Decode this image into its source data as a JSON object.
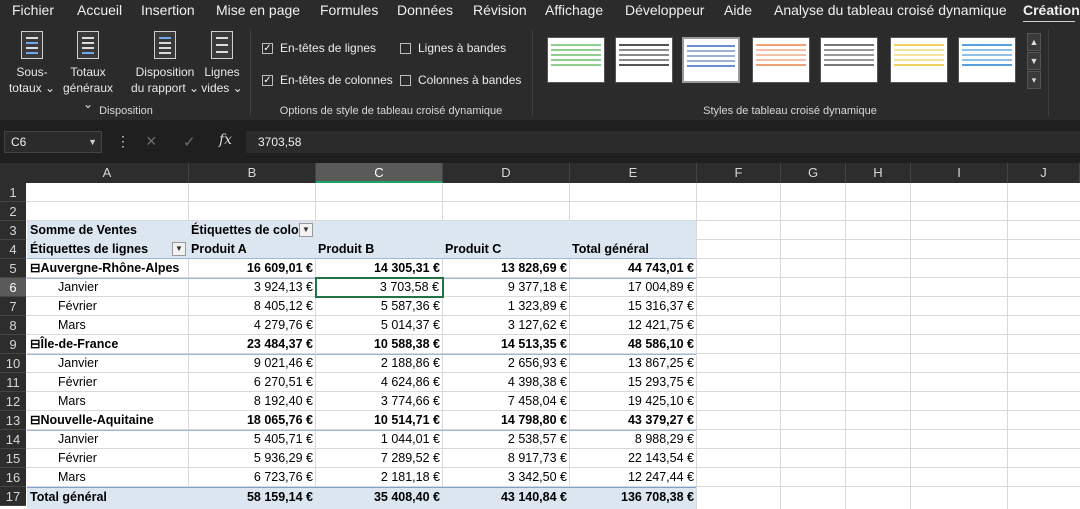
{
  "menu": {
    "tabs": [
      "Fichier",
      "Accueil",
      "Insertion",
      "Mise en page",
      "Formules",
      "Données",
      "Révision",
      "Affichage",
      "Développeur",
      "Aide",
      "Analyse du tableau croisé dynamique",
      "Création"
    ],
    "active": "Création"
  },
  "ribbon": {
    "disposition": {
      "buttons": [
        {
          "line1": "Sous-",
          "line2": "totaux ⌄"
        },
        {
          "line1": "Totaux",
          "line2": "généraux ⌄"
        },
        {
          "line1": "Disposition",
          "line2": "du rapport ⌄"
        },
        {
          "line1": "Lignes",
          "line2": "vides ⌄"
        }
      ],
      "label": "Disposition"
    },
    "options": {
      "checks": [
        {
          "label": "En-têtes de lignes",
          "checked": true
        },
        {
          "label": "Lignes à bandes",
          "checked": false
        },
        {
          "label": "En-têtes de colonnes",
          "checked": true
        },
        {
          "label": "Colonnes à bandes",
          "checked": false
        }
      ],
      "label": "Options de style de tableau croisé dynamique"
    },
    "styles": {
      "label": "Styles de tableau croisé dynamique",
      "swatches": [
        "#8fce8f",
        "#8a8a8a",
        "#6b8fd6",
        "#f0a078",
        "#9a9a9a",
        "#f2d060",
        "#5aa0e0"
      ],
      "selected_index": 2
    }
  },
  "formula_bar": {
    "name_box": "C6",
    "cancel_icon": "×",
    "enter_icon": "✓",
    "fx": "fx",
    "value": "3703,58"
  },
  "grid": {
    "columns": [
      "A",
      "B",
      "C",
      "D",
      "E",
      "F",
      "G",
      "H",
      "I",
      "J"
    ],
    "selected_column": "C",
    "rows": [
      "1",
      "2",
      "3",
      "4",
      "5",
      "6",
      "7",
      "8",
      "9",
      "10",
      "11",
      "12",
      "13",
      "14",
      "15",
      "16",
      "17"
    ],
    "selected_row": "6"
  },
  "pivot": {
    "values_label": "Somme de Ventes",
    "col_labels_label": "Étiquettes de colo",
    "row_labels_label": "Étiquettes de lignes",
    "headers": [
      "Produit A",
      "Produit B",
      "Produit C",
      "Total général"
    ],
    "rows": [
      {
        "label": "⊟Auvergne-Rhône-Alpes",
        "level": 0,
        "values": [
          "16 609,01 €",
          "14 305,31 €",
          "13 828,69 €",
          "44 743,01 €"
        ]
      },
      {
        "label": "Janvier",
        "level": 1,
        "values": [
          "3 924,13 €",
          "3 703,58 €",
          "9 377,18 €",
          "17 004,89 €"
        ]
      },
      {
        "label": "Février",
        "level": 1,
        "values": [
          "8 405,12 €",
          "5 587,36 €",
          "1 323,89 €",
          "15 316,37 €"
        ]
      },
      {
        "label": "Mars",
        "level": 1,
        "values": [
          "4 279,76 €",
          "5 014,37 €",
          "3 127,62 €",
          "12 421,75 €"
        ]
      },
      {
        "label": "⊟Île-de-France",
        "level": 0,
        "values": [
          "23 484,37 €",
          "10 588,38 €",
          "14 513,35 €",
          "48 586,10 €"
        ]
      },
      {
        "label": "Janvier",
        "level": 1,
        "values": [
          "9 021,46 €",
          "2 188,86 €",
          "2 656,93 €",
          "13 867,25 €"
        ]
      },
      {
        "label": "Février",
        "level": 1,
        "values": [
          "6 270,51 €",
          "4 624,86 €",
          "4 398,38 €",
          "15 293,75 €"
        ]
      },
      {
        "label": "Mars",
        "level": 1,
        "values": [
          "8 192,40 €",
          "3 774,66 €",
          "7 458,04 €",
          "19 425,10 €"
        ]
      },
      {
        "label": "⊟Nouvelle-Aquitaine",
        "level": 0,
        "values": [
          "18 065,76 €",
          "10 514,71 €",
          "14 798,80 €",
          "43 379,27 €"
        ]
      },
      {
        "label": "Janvier",
        "level": 1,
        "values": [
          "5 405,71 €",
          "1 044,01 €",
          "2 538,57 €",
          "8 988,29 €"
        ]
      },
      {
        "label": "Février",
        "level": 1,
        "values": [
          "5 936,29 €",
          "7 289,52 €",
          "8 917,73 €",
          "22 143,54 €"
        ]
      },
      {
        "label": "Mars",
        "level": 1,
        "values": [
          "6 723,76 €",
          "2 181,18 €",
          "3 342,50 €",
          "12 247,44 €"
        ]
      }
    ],
    "grand_total": {
      "label": "Total général",
      "values": [
        "58 159,14 €",
        "35 408,40 €",
        "43 140,84 €",
        "136 708,38 €"
      ]
    }
  }
}
